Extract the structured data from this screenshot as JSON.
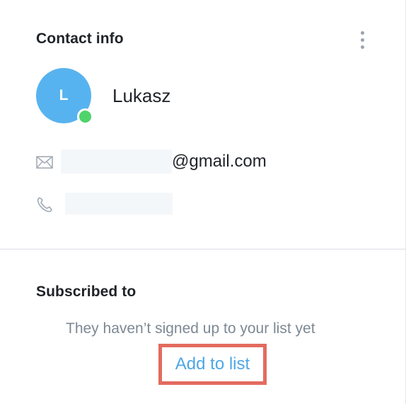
{
  "contact_info": {
    "title": "Contact info",
    "menu_icon": "more-vertical-icon",
    "avatar_initial": "L",
    "avatar_color": "#57b3ef",
    "status_color": "#4fd36b",
    "name": "Lukasz",
    "email_icon": "envelope-icon",
    "email_domain": "@gmail.com",
    "phone_icon": "phone-icon"
  },
  "subscribed": {
    "title": "Subscribed to",
    "empty_message": "They haven’t signed up to your list yet",
    "add_link": "Add to list",
    "link_color": "#4ea6e6",
    "highlight_color": "#e36b5f"
  }
}
